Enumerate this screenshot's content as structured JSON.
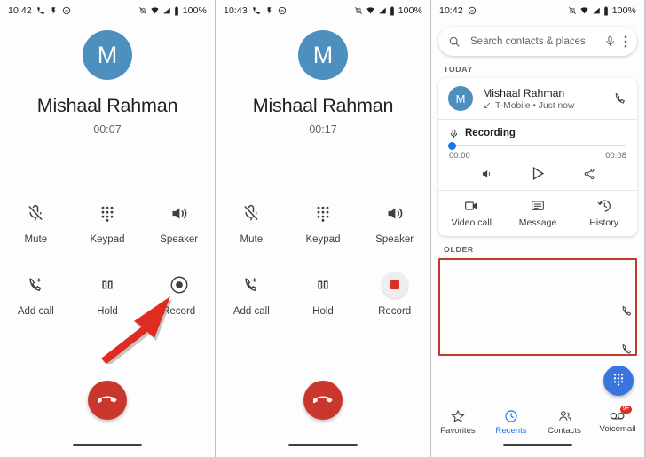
{
  "panels": {
    "call_before": {
      "status": {
        "time": "10:42",
        "battery": "100%",
        "left_icons": [
          "phone-call-icon",
          "lightning-icon",
          "do-not-disturb-icon"
        ],
        "right_icons": [
          "vibrate-off-icon",
          "wifi-icon",
          "signal-icon",
          "battery-icon"
        ]
      },
      "avatar_letter": "M",
      "contact_name": "Mishaal Rahman",
      "duration": "00:07",
      "buttons": [
        {
          "label": "Mute",
          "icon": "mic-off-icon"
        },
        {
          "label": "Keypad",
          "icon": "dialpad-icon"
        },
        {
          "label": "Speaker",
          "icon": "speaker-icon"
        },
        {
          "label": "Add call",
          "icon": "add-call-icon"
        },
        {
          "label": "Hold",
          "icon": "pause-icon"
        },
        {
          "label": "Record",
          "icon": "record-circle-icon"
        }
      ],
      "end_call": "end-call-icon"
    },
    "call_recording": {
      "status": {
        "time": "10:43",
        "battery": "100%",
        "left_icons": [
          "phone-call-icon",
          "lightning-icon",
          "do-not-disturb-icon"
        ],
        "right_icons": [
          "vibrate-off-icon",
          "wifi-icon",
          "signal-icon",
          "battery-icon"
        ]
      },
      "avatar_letter": "M",
      "contact_name": "Mishaal Rahman",
      "duration": "00:17",
      "buttons": [
        {
          "label": "Mute",
          "icon": "mic-off-icon"
        },
        {
          "label": "Keypad",
          "icon": "dialpad-icon"
        },
        {
          "label": "Speaker",
          "icon": "speaker-icon"
        },
        {
          "label": "Add call",
          "icon": "add-call-icon"
        },
        {
          "label": "Hold",
          "icon": "pause-icon"
        },
        {
          "label": "Record",
          "icon": "stop-record-icon"
        }
      ],
      "end_call": "end-call-icon"
    },
    "recents": {
      "status": {
        "time": "10:42",
        "battery": "100%",
        "left_icons": [
          "do-not-disturb-icon"
        ],
        "right_icons": [
          "vibrate-off-icon",
          "wifi-icon",
          "signal-icon",
          "battery-icon"
        ]
      },
      "search": {
        "placeholder": "Search contacts & places",
        "icon": "search-icon",
        "mic_icon": "mic-icon",
        "overflow_icon": "more-vert-icon"
      },
      "section_today": "TODAY",
      "section_older": "OLDER",
      "entry": {
        "avatar_letter": "M",
        "name": "Mishaal Rahman",
        "subtitle": "T-Mobile • Just now",
        "direction_icon": "outgoing-call-icon",
        "call_back_icon": "phone-icon"
      },
      "recording": {
        "label": "Recording",
        "mic_icon": "mic-icon",
        "elapsed": "00:00",
        "total": "00:08",
        "progress_percent": 0,
        "controls": [
          "volume-icon",
          "play-icon",
          "share-icon"
        ]
      },
      "actions": [
        {
          "label": "Video call",
          "icon": "video-call-icon"
        },
        {
          "label": "Message",
          "icon": "message-icon"
        },
        {
          "label": "History",
          "icon": "history-icon"
        }
      ],
      "fab_icon": "dialpad-fab-icon",
      "bottom_nav": [
        {
          "label": "Favorites",
          "icon": "star-icon",
          "active": false
        },
        {
          "label": "Recents",
          "icon": "clock-icon",
          "active": true
        },
        {
          "label": "Contacts",
          "icon": "people-icon",
          "active": false
        },
        {
          "label": "Voicemail",
          "icon": "voicemail-icon",
          "active": false,
          "badge": "9+"
        }
      ]
    }
  },
  "colors": {
    "avatar_blue": "#4d90bf",
    "accent_blue": "#1a73e8",
    "fab_blue": "#3a74dd",
    "end_call_red": "#c9372c",
    "annotation_red": "#e02b20",
    "redaction_red": "#c0392b",
    "record_red": "#d93025"
  }
}
